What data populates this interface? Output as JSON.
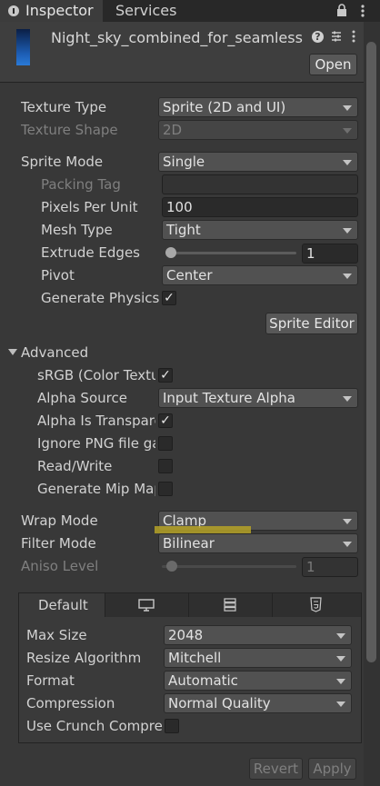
{
  "tabs": {
    "inspector": "Inspector",
    "services": "Services"
  },
  "header": {
    "asset_name": "Night_sky_combined_for_seamless",
    "open_label": "Open"
  },
  "texture_type": {
    "label": "Texture Type",
    "value": "Sprite (2D and UI)"
  },
  "texture_shape": {
    "label": "Texture Shape",
    "value": "2D"
  },
  "sprite_mode": {
    "label": "Sprite Mode",
    "value": "Single"
  },
  "packing_tag": {
    "label": "Packing Tag",
    "value": ""
  },
  "pixels_per_unit": {
    "label": "Pixels Per Unit",
    "value": "100"
  },
  "mesh_type": {
    "label": "Mesh Type",
    "value": "Tight"
  },
  "extrude_edges": {
    "label": "Extrude Edges",
    "value": "1"
  },
  "pivot": {
    "label": "Pivot",
    "value": "Center"
  },
  "generate_physics": {
    "label": "Generate Physics",
    "checked": true
  },
  "sprite_editor_label": "Sprite Editor",
  "advanced": {
    "label": "Advanced",
    "srgb": {
      "label": "sRGB (Color Textu",
      "checked": true
    },
    "alpha_source": {
      "label": "Alpha Source",
      "value": "Input Texture Alpha"
    },
    "alpha_transparency": {
      "label": "Alpha Is Transpare",
      "checked": true
    },
    "ignore_png": {
      "label": "Ignore PNG file ga",
      "checked": false
    },
    "read_write": {
      "label": "Read/Write",
      "checked": false
    },
    "generate_mip": {
      "label": "Generate Mip Map",
      "checked": false
    }
  },
  "wrap_mode": {
    "label": "Wrap Mode",
    "value": "Clamp",
    "highlight_color": "#b5a227"
  },
  "filter_mode": {
    "label": "Filter Mode",
    "value": "Bilinear"
  },
  "aniso_level": {
    "label": "Aniso Level",
    "value": "1"
  },
  "platform": {
    "tabs": [
      {
        "label": "Default",
        "icon": ""
      },
      {
        "label": "",
        "icon": "monitor-icon"
      },
      {
        "label": "",
        "icon": "server-icon"
      },
      {
        "label": "",
        "icon": "html5-icon"
      }
    ],
    "max_size": {
      "label": "Max Size",
      "value": "2048"
    },
    "resize_algorithm": {
      "label": "Resize Algorithm",
      "value": "Mitchell"
    },
    "format": {
      "label": "Format",
      "value": "Automatic"
    },
    "compression": {
      "label": "Compression",
      "value": "Normal Quality"
    },
    "use_crunch": {
      "label": "Use Crunch Compres",
      "checked": false
    }
  },
  "footer": {
    "revert_label": "Revert",
    "apply_label": "Apply"
  }
}
